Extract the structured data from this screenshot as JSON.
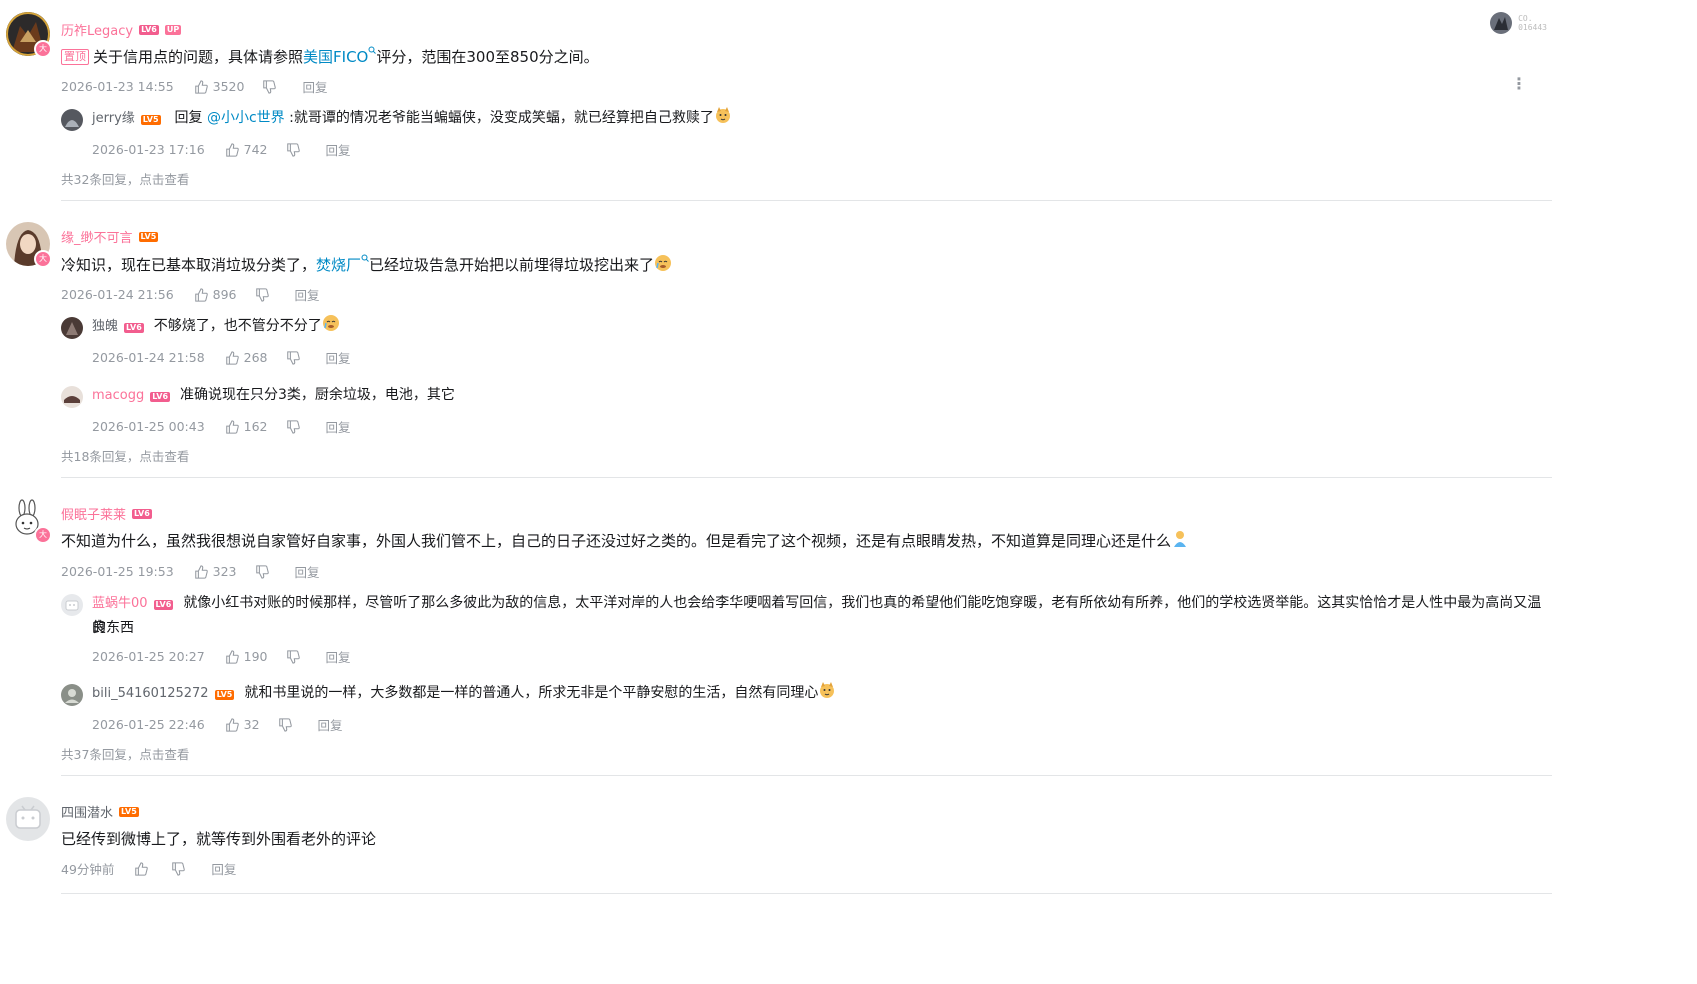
{
  "top_right": {
    "code_line1": "CO.",
    "code_line2": "016443"
  },
  "threads": [
    {
      "username": "历祚Legacy",
      "badges": [
        "LV6",
        "UP"
      ],
      "pinned_label": "置顶",
      "content_before": "关于信用点的问题，具体请参照",
      "content_link": "美国FICO",
      "content_after": "评分，范围在300至850分之间。",
      "time": "2026-01-23 14:55",
      "likes": "3520",
      "reply_label": "回复",
      "replies": [
        {
          "username": "jerry缘",
          "level": "LV5",
          "text_prefix": "回复 ",
          "mention": "@小小c世界",
          "text": " :就哥谭的情况老爷能当蝙蝠侠，没变成笑蝠，就已经算把自己救赎了",
          "time": "2026-01-23 17:16",
          "likes": "742",
          "reply_label": "回复"
        }
      ],
      "view_more": "共32条回复，点击查看"
    },
    {
      "username": "缘_缈不可言",
      "badges": [
        "LV5"
      ],
      "content_before": "冷知识，现在已基本取消垃圾分类了，",
      "content_link": "焚烧厂",
      "content_after": "已经垃圾告急开始把以前埋得垃圾挖出来了",
      "time": "2026-01-24 21:56",
      "likes": "896",
      "reply_label": "回复",
      "replies": [
        {
          "username": "独魄",
          "level": "LV6",
          "text": "不够烧了，也不管分不分了",
          "time": "2026-01-24 21:58",
          "likes": "268",
          "reply_label": "回复"
        },
        {
          "username": "macogg",
          "level": "LV6",
          "text": "准确说现在只分3类，厨余垃圾，电池，其它",
          "time": "2026-01-25 00:43",
          "likes": "162",
          "reply_label": "回复"
        }
      ],
      "view_more": "共18条回复，点击查看"
    },
    {
      "username": "假眠子莱莱",
      "badges": [
        "LV6"
      ],
      "content_before": "不知道为什么，虽然我很想说自家管好自家事，外国人我们管不上，自己的日子还没过好之类的。但是看完了这个视频，还是有点眼睛发热，不知道算是同理心还是什么",
      "content_link": "",
      "content_after": "",
      "time": "2026-01-25 19:53",
      "likes": "323",
      "reply_label": "回复",
      "replies": [
        {
          "username": "蓝蜗牛00",
          "level": "LV6",
          "text": "就像小红书对账的时候那样，尽管听了那么多彼此为敌的信息，太平洋对岸的人也会给李华哽咽着写回信，我们也真的希望他们能吃饱穿暖，老有所依幼有所养，他们的学校选贤举能。这其实恰恰才是人性中最为高尚又温良",
          "text2": "的东西",
          "time": "2026-01-25 20:27",
          "likes": "190",
          "reply_label": "回复"
        },
        {
          "username": "bili_54160125272",
          "level": "LV5",
          "text": "就和书里说的一样，大多数都是一样的普通人，所求无非是个平静安慰的生活，自然有同理心",
          "time": "2026-01-25 22:46",
          "likes": "32",
          "reply_label": "回复"
        }
      ],
      "view_more": "共37条回复，点击查看"
    },
    {
      "username": "四围潜水",
      "badges": [
        "LV5"
      ],
      "content_before": "已经传到微博上了，就等传到外围看老外的评论",
      "content_link": "",
      "content_after": "",
      "time": "49分钟前",
      "likes": "",
      "reply_label": "回复",
      "replies": [],
      "view_more": ""
    }
  ]
}
